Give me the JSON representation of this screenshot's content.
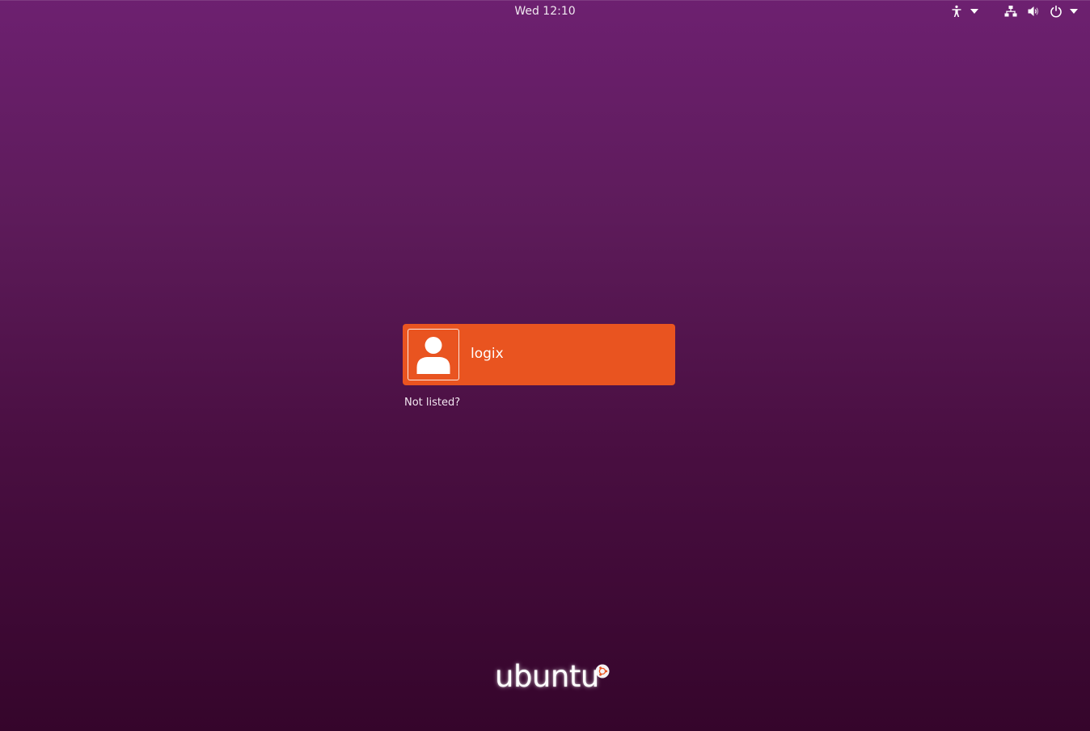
{
  "topbar": {
    "clock": "Wed 12:10",
    "icons": {
      "accessibility": "accessibility-icon",
      "network": "network-wired-icon",
      "volume": "volume-icon",
      "power": "power-icon",
      "menu_arrow": "chevron-down-icon"
    }
  },
  "users": [
    {
      "name": "logix",
      "avatar": "user-avatar-icon"
    }
  ],
  "not_listed": "Not listed?",
  "logo": {
    "text": "ubuntu",
    "mark": "circle-of-friends-icon"
  },
  "colors": {
    "accent": "#e95420",
    "background_top": "#6d2070",
    "background_bottom": "#35052b"
  }
}
